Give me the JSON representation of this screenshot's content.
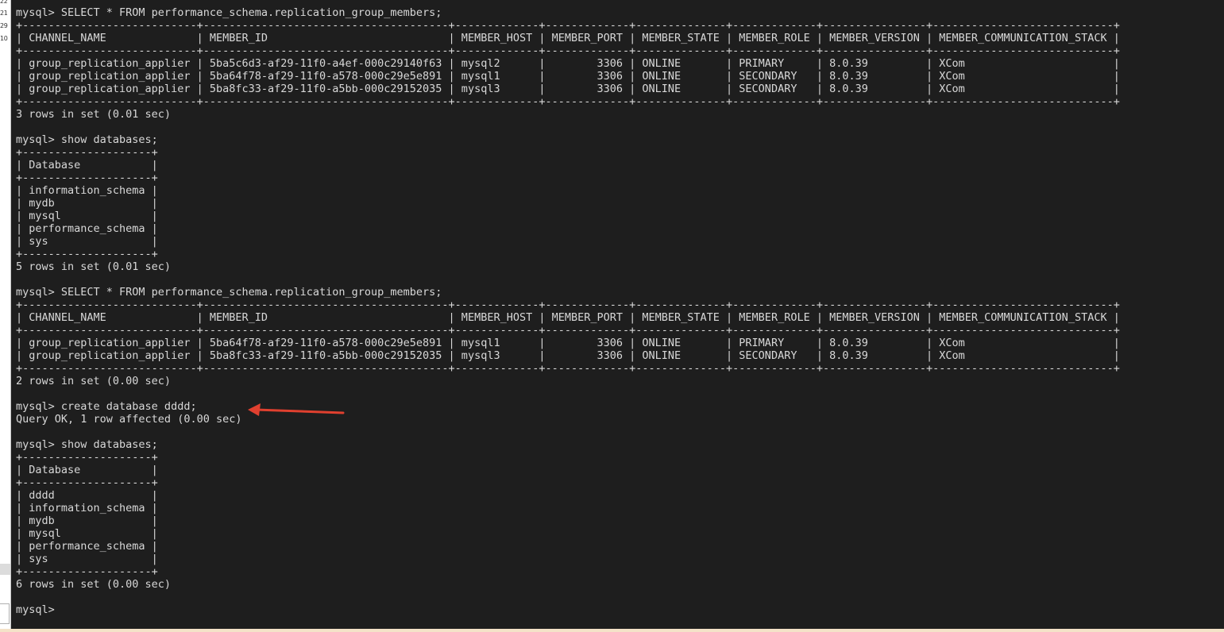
{
  "gutter": {
    "numbers": [
      "22",
      "21",
      "29",
      "10"
    ]
  },
  "terminal": {
    "lines": [
      "mysql> SELECT * FROM performance_schema.replication_group_members;",
      "+---------------------------+--------------------------------------+-------------+-------------+--------------+-------------+----------------+----------------------------+",
      "| CHANNEL_NAME              | MEMBER_ID                            | MEMBER_HOST | MEMBER_PORT | MEMBER_STATE | MEMBER_ROLE | MEMBER_VERSION | MEMBER_COMMUNICATION_STACK |",
      "+---------------------------+--------------------------------------+-------------+-------------+--------------+-------------+----------------+----------------------------+",
      "| group_replication_applier | 5ba5c6d3-af29-11f0-a4ef-000c29140f63 | mysql2      |        3306 | ONLINE       | PRIMARY     | 8.0.39         | XCom                       |",
      "| group_replication_applier | 5ba64f78-af29-11f0-a578-000c29e5e891 | mysql1      |        3306 | ONLINE       | SECONDARY   | 8.0.39         | XCom                       |",
      "| group_replication_applier | 5ba8fc33-af29-11f0-a5bb-000c29152035 | mysql3      |        3306 | ONLINE       | SECONDARY   | 8.0.39         | XCom                       |",
      "+---------------------------+--------------------------------------+-------------+-------------+--------------+-------------+----------------+----------------------------+",
      "3 rows in set (0.01 sec)",
      "",
      "mysql> show databases;",
      "+--------------------+",
      "| Database           |",
      "+--------------------+",
      "| information_schema |",
      "| mydb               |",
      "| mysql              |",
      "| performance_schema |",
      "| sys                |",
      "+--------------------+",
      "5 rows in set (0.01 sec)",
      "",
      "mysql> SELECT * FROM performance_schema.replication_group_members;",
      "+---------------------------+--------------------------------------+-------------+-------------+--------------+-------------+----------------+----------------------------+",
      "| CHANNEL_NAME              | MEMBER_ID                            | MEMBER_HOST | MEMBER_PORT | MEMBER_STATE | MEMBER_ROLE | MEMBER_VERSION | MEMBER_COMMUNICATION_STACK |",
      "+---------------------------+--------------------------------------+-------------+-------------+--------------+-------------+----------------+----------------------------+",
      "| group_replication_applier | 5ba64f78-af29-11f0-a578-000c29e5e891 | mysql1      |        3306 | ONLINE       | PRIMARY     | 8.0.39         | XCom                       |",
      "| group_replication_applier | 5ba8fc33-af29-11f0-a5bb-000c29152035 | mysql3      |        3306 | ONLINE       | SECONDARY   | 8.0.39         | XCom                       |",
      "+---------------------------+--------------------------------------+-------------+-------------+--------------+-------------+----------------+----------------------------+",
      "2 rows in set (0.00 sec)",
      "",
      "mysql> create database dddd;",
      "Query OK, 1 row affected (0.00 sec)",
      "",
      "mysql> show databases;",
      "+--------------------+",
      "| Database           |",
      "+--------------------+",
      "| dddd               |",
      "| information_schema |",
      "| mydb               |",
      "| mysql              |",
      "| performance_schema |",
      "| sys                |",
      "+--------------------+",
      "6 rows in set (0.00 sec)",
      "",
      "mysql> "
    ],
    "prompt_line_index": 48
  },
  "colors": {
    "background": "#1e1e1e",
    "text": "#d8d8d8",
    "annotation_arrow": "#e0402f"
  },
  "annotation": {
    "icon": "red-arrow-icon"
  }
}
